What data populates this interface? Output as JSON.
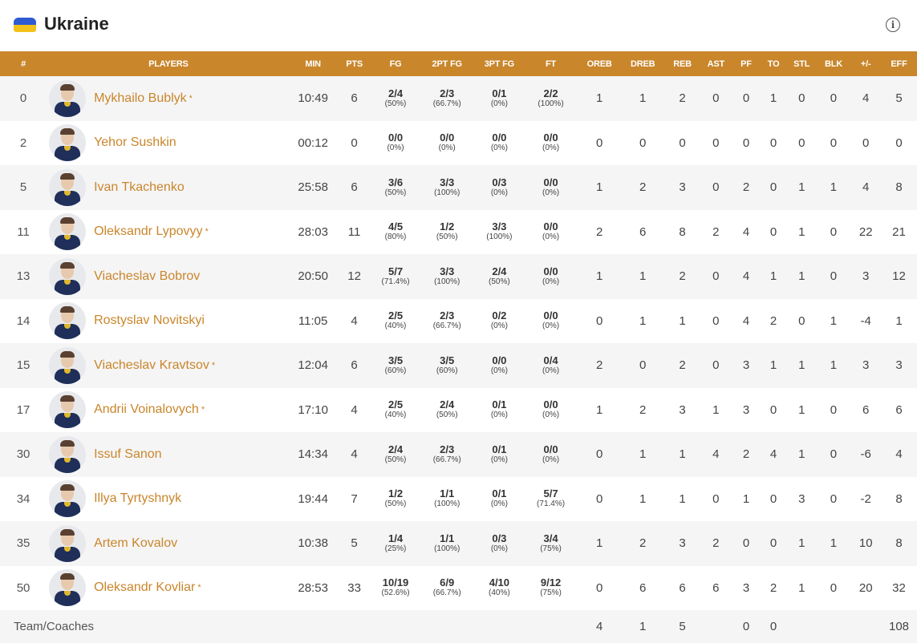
{
  "team": {
    "name": "Ukraine",
    "info_icon": "info-icon"
  },
  "columns": [
    "#",
    "PLAYERS",
    "MIN",
    "PTS",
    "FG",
    "2PT FG",
    "3PT FG",
    "FT",
    "OREB",
    "DREB",
    "REB",
    "AST",
    "PF",
    "TO",
    "STL",
    "BLK",
    "+/-",
    "EFF"
  ],
  "colors": {
    "header_bg": "#c9862b",
    "name_color": "#c9862b",
    "row_stripe": "#f5f5f6"
  },
  "players": [
    {
      "num": "0",
      "name": "Mykhailo Bublyk",
      "starter": true,
      "min": "10:49",
      "pts": "6",
      "fg": "2/4",
      "fg_pct": "(50%)",
      "p2": "2/3",
      "p2_pct": "(66.7%)",
      "p3": "0/1",
      "p3_pct": "(0%)",
      "ft": "2/2",
      "ft_pct": "(100%)",
      "oreb": "1",
      "dreb": "1",
      "reb": "2",
      "ast": "0",
      "pf": "0",
      "to": "1",
      "stl": "0",
      "blk": "0",
      "pm": "4",
      "eff": "5"
    },
    {
      "num": "2",
      "name": "Yehor Sushkin",
      "starter": false,
      "min": "00:12",
      "pts": "0",
      "fg": "0/0",
      "fg_pct": "(0%)",
      "p2": "0/0",
      "p2_pct": "(0%)",
      "p3": "0/0",
      "p3_pct": "(0%)",
      "ft": "0/0",
      "ft_pct": "(0%)",
      "oreb": "0",
      "dreb": "0",
      "reb": "0",
      "ast": "0",
      "pf": "0",
      "to": "0",
      "stl": "0",
      "blk": "0",
      "pm": "0",
      "eff": "0"
    },
    {
      "num": "5",
      "name": "Ivan Tkachenko",
      "starter": false,
      "min": "25:58",
      "pts": "6",
      "fg": "3/6",
      "fg_pct": "(50%)",
      "p2": "3/3",
      "p2_pct": "(100%)",
      "p3": "0/3",
      "p3_pct": "(0%)",
      "ft": "0/0",
      "ft_pct": "(0%)",
      "oreb": "1",
      "dreb": "2",
      "reb": "3",
      "ast": "0",
      "pf": "2",
      "to": "0",
      "stl": "1",
      "blk": "1",
      "pm": "4",
      "eff": "8"
    },
    {
      "num": "11",
      "name": "Oleksandr Lypovyy",
      "starter": true,
      "min": "28:03",
      "pts": "11",
      "fg": "4/5",
      "fg_pct": "(80%)",
      "p2": "1/2",
      "p2_pct": "(50%)",
      "p3": "3/3",
      "p3_pct": "(100%)",
      "ft": "0/0",
      "ft_pct": "(0%)",
      "oreb": "2",
      "dreb": "6",
      "reb": "8",
      "ast": "2",
      "pf": "4",
      "to": "0",
      "stl": "1",
      "blk": "0",
      "pm": "22",
      "eff": "21"
    },
    {
      "num": "13",
      "name": "Viacheslav Bobrov",
      "starter": false,
      "min": "20:50",
      "pts": "12",
      "fg": "5/7",
      "fg_pct": "(71.4%)",
      "p2": "3/3",
      "p2_pct": "(100%)",
      "p3": "2/4",
      "p3_pct": "(50%)",
      "ft": "0/0",
      "ft_pct": "(0%)",
      "oreb": "1",
      "dreb": "1",
      "reb": "2",
      "ast": "0",
      "pf": "4",
      "to": "1",
      "stl": "1",
      "blk": "0",
      "pm": "3",
      "eff": "12"
    },
    {
      "num": "14",
      "name": "Rostyslav Novitskyi",
      "starter": false,
      "min": "11:05",
      "pts": "4",
      "fg": "2/5",
      "fg_pct": "(40%)",
      "p2": "2/3",
      "p2_pct": "(66.7%)",
      "p3": "0/2",
      "p3_pct": "(0%)",
      "ft": "0/0",
      "ft_pct": "(0%)",
      "oreb": "0",
      "dreb": "1",
      "reb": "1",
      "ast": "0",
      "pf": "4",
      "to": "2",
      "stl": "0",
      "blk": "1",
      "pm": "-4",
      "eff": "1"
    },
    {
      "num": "15",
      "name": "Viacheslav Kravtsov",
      "starter": true,
      "min": "12:04",
      "pts": "6",
      "fg": "3/5",
      "fg_pct": "(60%)",
      "p2": "3/5",
      "p2_pct": "(60%)",
      "p3": "0/0",
      "p3_pct": "(0%)",
      "ft": "0/4",
      "ft_pct": "(0%)",
      "oreb": "2",
      "dreb": "0",
      "reb": "2",
      "ast": "0",
      "pf": "3",
      "to": "1",
      "stl": "1",
      "blk": "1",
      "pm": "3",
      "eff": "3"
    },
    {
      "num": "17",
      "name": "Andrii Voinalovych",
      "starter": true,
      "min": "17:10",
      "pts": "4",
      "fg": "2/5",
      "fg_pct": "(40%)",
      "p2": "2/4",
      "p2_pct": "(50%)",
      "p3": "0/1",
      "p3_pct": "(0%)",
      "ft": "0/0",
      "ft_pct": "(0%)",
      "oreb": "1",
      "dreb": "2",
      "reb": "3",
      "ast": "1",
      "pf": "3",
      "to": "0",
      "stl": "1",
      "blk": "0",
      "pm": "6",
      "eff": "6"
    },
    {
      "num": "30",
      "name": "Issuf Sanon",
      "starter": false,
      "min": "14:34",
      "pts": "4",
      "fg": "2/4",
      "fg_pct": "(50%)",
      "p2": "2/3",
      "p2_pct": "(66.7%)",
      "p3": "0/1",
      "p3_pct": "(0%)",
      "ft": "0/0",
      "ft_pct": "(0%)",
      "oreb": "0",
      "dreb": "1",
      "reb": "1",
      "ast": "4",
      "pf": "2",
      "to": "4",
      "stl": "1",
      "blk": "0",
      "pm": "-6",
      "eff": "4"
    },
    {
      "num": "34",
      "name": "Illya Tyrtyshnyk",
      "starter": false,
      "min": "19:44",
      "pts": "7",
      "fg": "1/2",
      "fg_pct": "(50%)",
      "p2": "1/1",
      "p2_pct": "(100%)",
      "p3": "0/1",
      "p3_pct": "(0%)",
      "ft": "5/7",
      "ft_pct": "(71.4%)",
      "oreb": "0",
      "dreb": "1",
      "reb": "1",
      "ast": "0",
      "pf": "1",
      "to": "0",
      "stl": "3",
      "blk": "0",
      "pm": "-2",
      "eff": "8"
    },
    {
      "num": "35",
      "name": "Artem Kovalov",
      "starter": false,
      "min": "10:38",
      "pts": "5",
      "fg": "1/4",
      "fg_pct": "(25%)",
      "p2": "1/1",
      "p2_pct": "(100%)",
      "p3": "0/3",
      "p3_pct": "(0%)",
      "ft": "3/4",
      "ft_pct": "(75%)",
      "oreb": "1",
      "dreb": "2",
      "reb": "3",
      "ast": "2",
      "pf": "0",
      "to": "0",
      "stl": "1",
      "blk": "1",
      "pm": "10",
      "eff": "8"
    },
    {
      "num": "50",
      "name": "Oleksandr Kovliar",
      "starter": true,
      "min": "28:53",
      "pts": "33",
      "fg": "10/19",
      "fg_pct": "(52.6%)",
      "p2": "6/9",
      "p2_pct": "(66.7%)",
      "p3": "4/10",
      "p3_pct": "(40%)",
      "ft": "9/12",
      "ft_pct": "(75%)",
      "oreb": "0",
      "dreb": "6",
      "reb": "6",
      "ast": "6",
      "pf": "3",
      "to": "2",
      "stl": "1",
      "blk": "0",
      "pm": "20",
      "eff": "32"
    }
  ],
  "team_row": {
    "label": "Team/Coaches",
    "oreb": "4",
    "dreb": "1",
    "reb": "5",
    "pf": "0",
    "to": "0",
    "eff": "108"
  }
}
